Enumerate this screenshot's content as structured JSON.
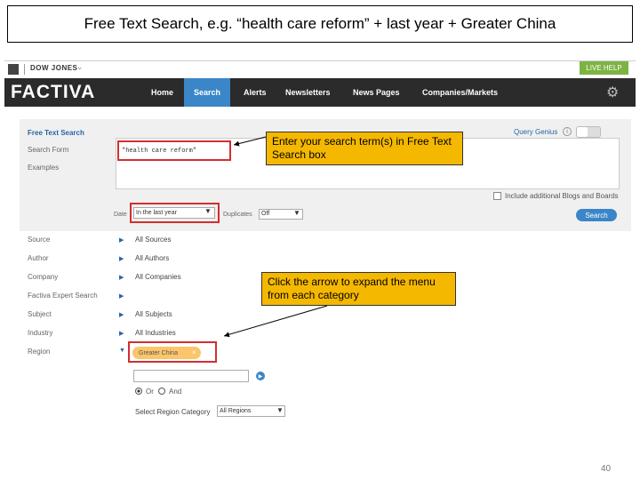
{
  "slide": {
    "title": "Free Text Search, e.g. “health care reform” + last year + Greater China",
    "page_number": "40"
  },
  "topbar": {
    "brand": "DOW JONES",
    "live_help": "LIVE HELP"
  },
  "navbar": {
    "logo": "FACTIVA",
    "items": [
      "Home",
      "Search",
      "Alerts",
      "Newsletters",
      "News Pages",
      "Companies/Markets"
    ],
    "active": "Search",
    "icon": "gear-icon"
  },
  "search_panel": {
    "left_links": [
      "Free Text Search",
      "Search Form",
      "Examples"
    ],
    "query_text": "\"health care reform\"",
    "query_genius_label": "Query Genius",
    "blogs_label": "Include additional Blogs and Boards",
    "date_label": "Date",
    "date_value": "In the last year",
    "duplicates_label": "Duplicates",
    "duplicates_value": "Off",
    "search_button": "Search"
  },
  "categories": [
    {
      "label": "Source",
      "value": "All Sources"
    },
    {
      "label": "Author",
      "value": "All Authors"
    },
    {
      "label": "Company",
      "value": "All Companies"
    },
    {
      "label": "Factiva Expert Search",
      "value": ""
    },
    {
      "label": "Subject",
      "value": "All Subjects"
    },
    {
      "label": "Industry",
      "value": "All Industries"
    },
    {
      "label": "Region",
      "value": ""
    }
  ],
  "region": {
    "selected_tag": "Greater China",
    "radio_or": "Or",
    "radio_and": "And",
    "category_label": "Select Region Category",
    "category_value": "All Regions"
  },
  "callouts": {
    "callout_1": "Enter your search term(s) in Free Text Search box",
    "callout_2": "Click the arrow to expand the menu from each category"
  },
  "colors": {
    "nav_bg": "#2b2b2b",
    "accent_blue": "#3a86c8",
    "callout": "#f5b800",
    "highlight_red": "#d32f2f",
    "live_help_green": "#7cb342"
  }
}
